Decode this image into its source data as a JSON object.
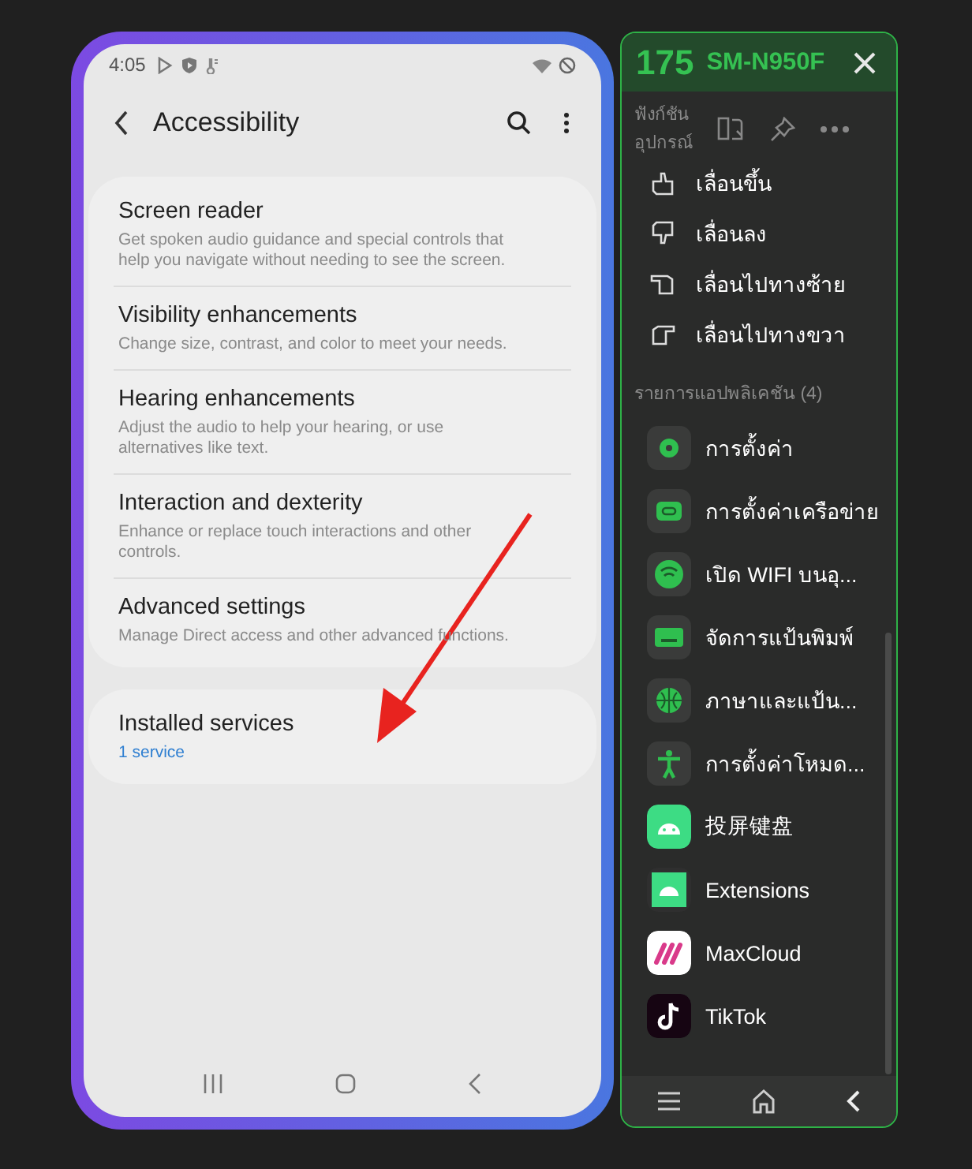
{
  "phone": {
    "status_bar": {
      "time": "4:05"
    },
    "app_bar": {
      "title": "Accessibility"
    },
    "groups": [
      {
        "items": [
          {
            "title": "Screen reader",
            "subtitle": "Get spoken audio guidance and special controls that help you navigate without needing to see the screen."
          },
          {
            "title": "Visibility enhancements",
            "subtitle": "Change size, contrast, and color to meet your needs."
          },
          {
            "title": "Hearing enhancements",
            "subtitle": "Adjust the audio to help your hearing, or use alternatives like text."
          },
          {
            "title": "Interaction and dexterity",
            "subtitle": "Enhance or replace touch interactions and other controls."
          },
          {
            "title": "Advanced settings",
            "subtitle": "Manage Direct access and other advanced functions."
          }
        ]
      },
      {
        "items": [
          {
            "title": "Installed services",
            "subtitle": "1 service",
            "kind": "link"
          }
        ]
      }
    ]
  },
  "panel": {
    "device_number": "175",
    "device_name": "SM-N950F",
    "section_label": "ฟังก์ชันอุปกรณ์",
    "gestures": [
      {
        "label": "เลื่อนขึ้น"
      },
      {
        "label": "เลื่อนลง"
      },
      {
        "label": "เลื่อนไปทางซ้าย"
      },
      {
        "label": "เลื่อนไปทางขวา"
      }
    ],
    "apps_label": "รายการแอปพลิเคชัน (4)",
    "apps": [
      {
        "label": "การตั้งค่า",
        "kind": "system"
      },
      {
        "label": "การตั้งค่าเครือข่าย",
        "kind": "system"
      },
      {
        "label": "เปิด WIFI บนอุ...",
        "kind": "system"
      },
      {
        "label": "จัดการแป้นพิมพ์",
        "kind": "system"
      },
      {
        "label": "ภาษาและแป้น...",
        "kind": "system"
      },
      {
        "label": "การตั้งค่าโหมด...",
        "kind": "system"
      },
      {
        "label": "投屏键盘",
        "kind": "app"
      },
      {
        "label": "Extensions",
        "kind": "app"
      },
      {
        "label": "MaxCloud",
        "kind": "app"
      },
      {
        "label": "TikTok",
        "kind": "app"
      }
    ]
  }
}
